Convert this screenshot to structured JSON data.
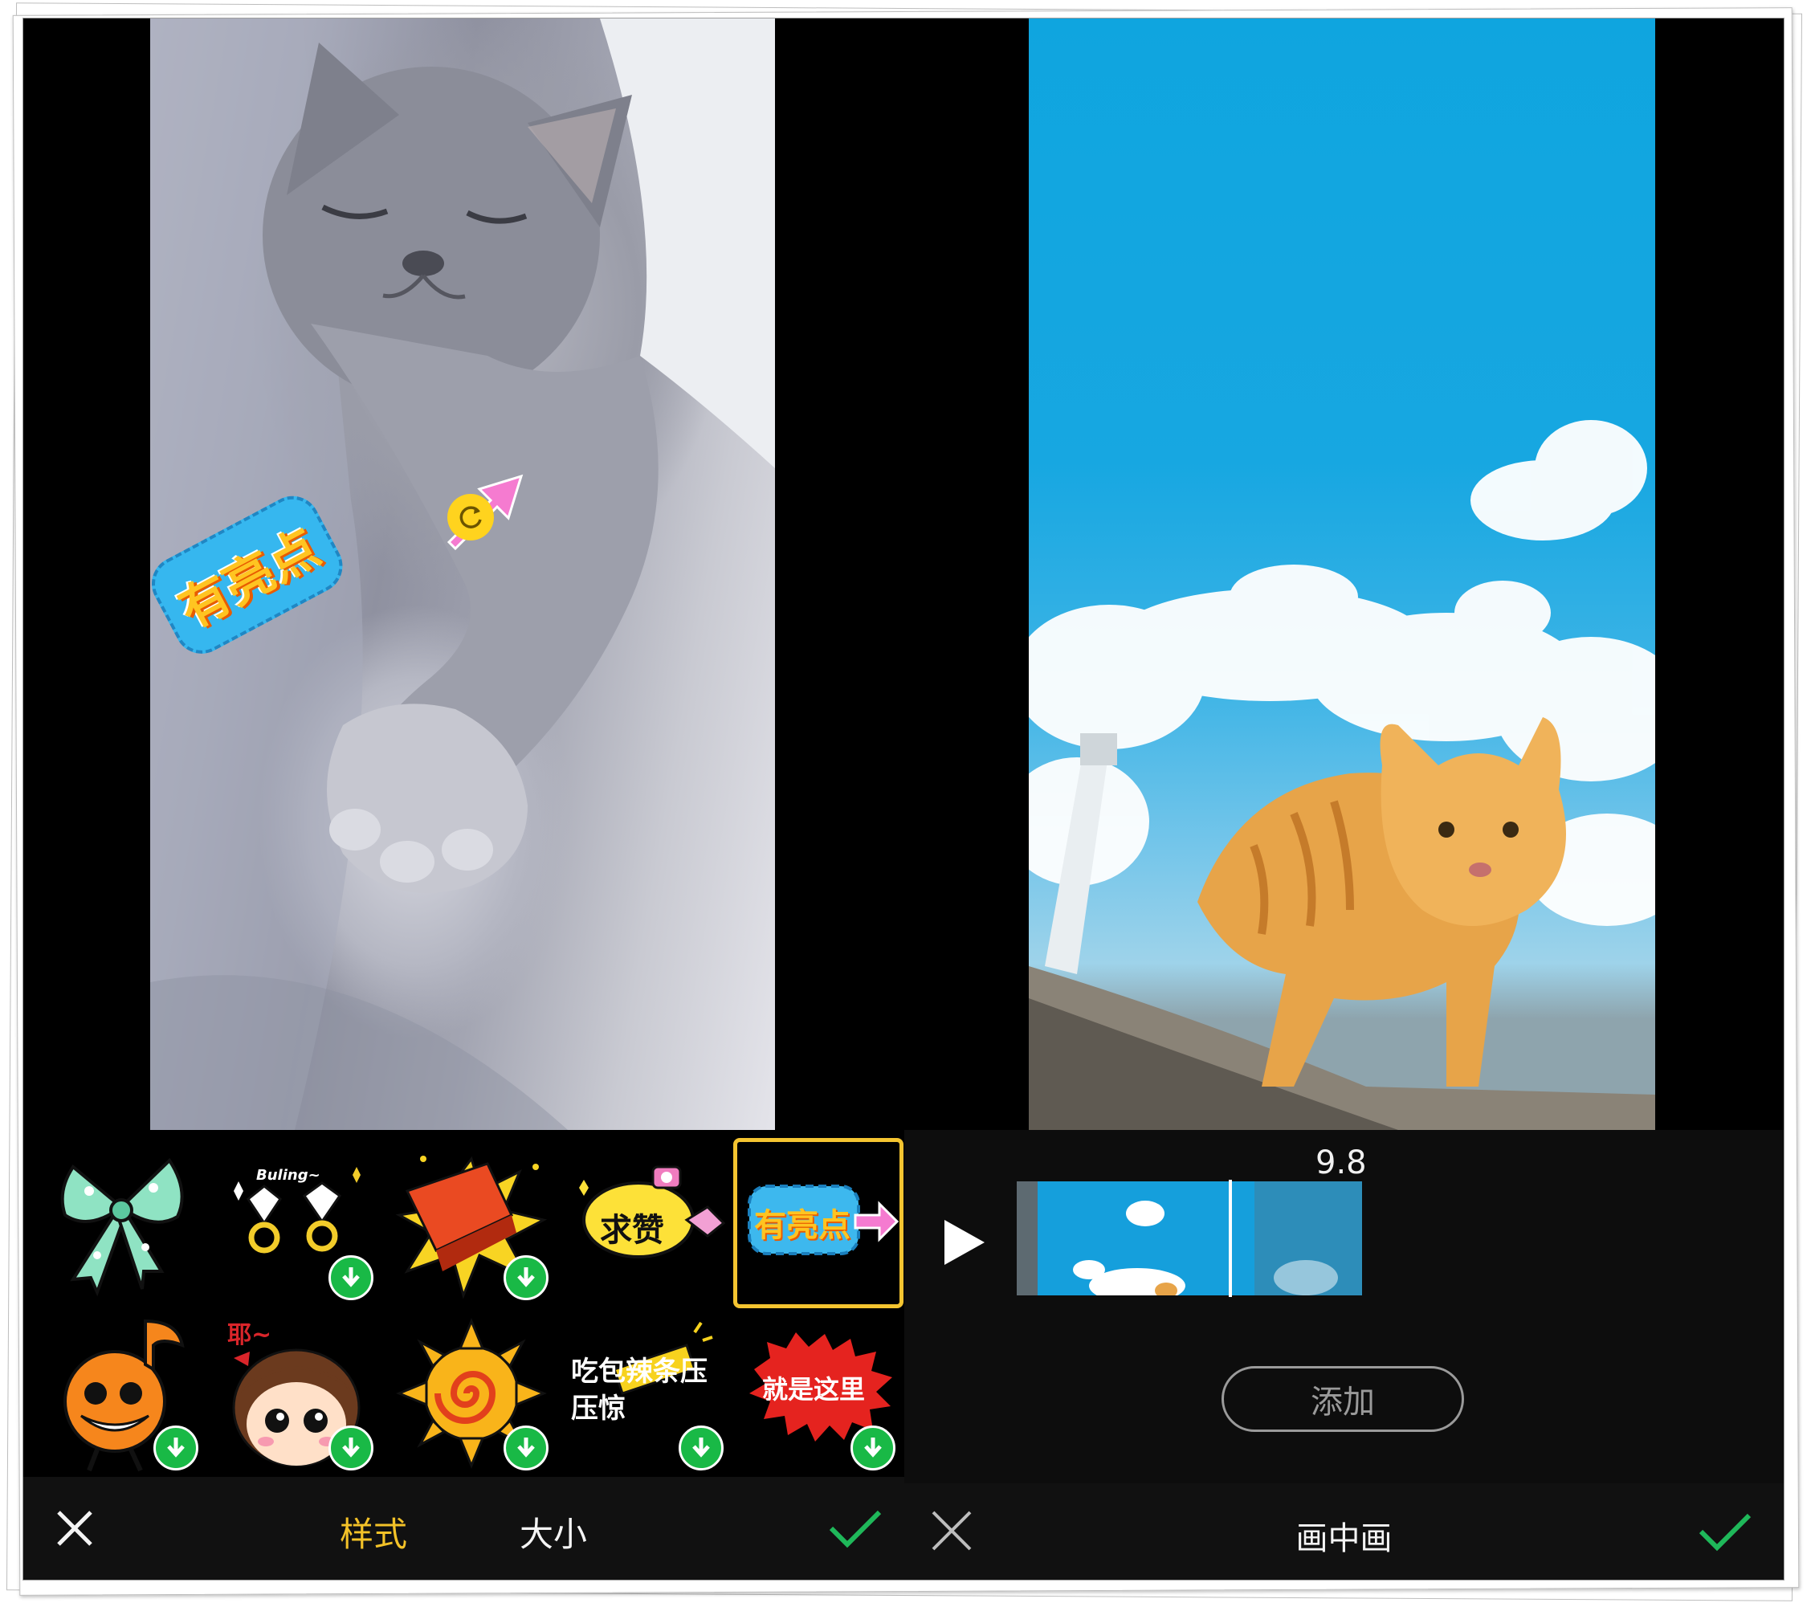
{
  "left_panel": {
    "preview_sticker_text": "有亮点",
    "stickers": [
      {
        "name": "bow",
        "text": "",
        "downloaded": true,
        "selected": false
      },
      {
        "name": "buling-diamonds",
        "text": "Buling~",
        "downloaded": false,
        "selected": false
      },
      {
        "name": "explosion-block",
        "text": "",
        "downloaded": false,
        "selected": false
      },
      {
        "name": "qiu-zan",
        "text": "求赞",
        "downloaded": true,
        "selected": false
      },
      {
        "name": "you-liang-dian",
        "text": "有亮点",
        "downloaded": true,
        "selected": true
      },
      {
        "name": "orange-note-face",
        "text": "",
        "downloaded": false,
        "selected": false
      },
      {
        "name": "shy-girl",
        "text": "耶~",
        "downloaded": false,
        "selected": false
      },
      {
        "name": "spiral-sun",
        "text": "",
        "downloaded": false,
        "selected": false
      },
      {
        "name": "eat-latiao",
        "text": "吃包辣条压压惊",
        "downloaded": false,
        "selected": false
      },
      {
        "name": "jiu-shi-zhe-li",
        "text": "就是这里",
        "downloaded": false,
        "selected": false
      }
    ],
    "bottom_bar": {
      "close_icon": "close-icon",
      "tab_style": "样式",
      "tab_size": "大小",
      "confirm_icon": "check-icon"
    },
    "colors": {
      "accent": "#f3c228",
      "confirm": "#1fb85a",
      "download": "#19b946"
    }
  },
  "right_panel": {
    "time_label": "9.8",
    "play_icon": "play-icon",
    "add_button": "添加",
    "bottom_bar": {
      "close_icon": "close-icon",
      "title": "画中画",
      "confirm_icon": "check-icon"
    }
  }
}
